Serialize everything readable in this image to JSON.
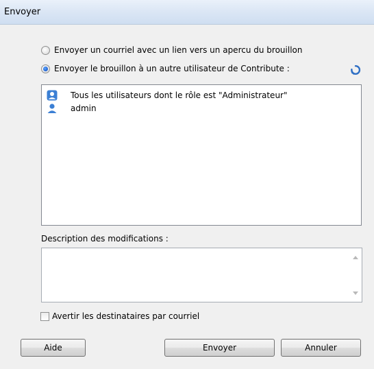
{
  "window": {
    "title": "Envoyer"
  },
  "options": {
    "email_link_label": "Envoyer un courriel avec un lien vers un apercu du brouillon",
    "email_link_selected": false,
    "send_to_user_label": "Envoyer le brouillon à un autre utilisateur de Contribute :",
    "send_to_user_selected": true,
    "refresh_icon": "refresh-icon"
  },
  "user_list": {
    "items": [
      {
        "label": "Tous les utilisateurs dont le rôle est \"Administrateur\"",
        "icon": "user-group-icon"
      },
      {
        "label": "admin",
        "icon": "user-icon"
      }
    ]
  },
  "description": {
    "label": "Description des modifications :",
    "value": ""
  },
  "notify": {
    "label": "Avertir les destinataires par courriel",
    "checked": false
  },
  "buttons": {
    "help": "Aide",
    "send": "Envoyer",
    "cancel": "Annuler"
  },
  "colors": {
    "accent": "#1d5fcf",
    "icon_blue": "#3b7fd4",
    "refresh_blue": "#2e6fc4"
  }
}
